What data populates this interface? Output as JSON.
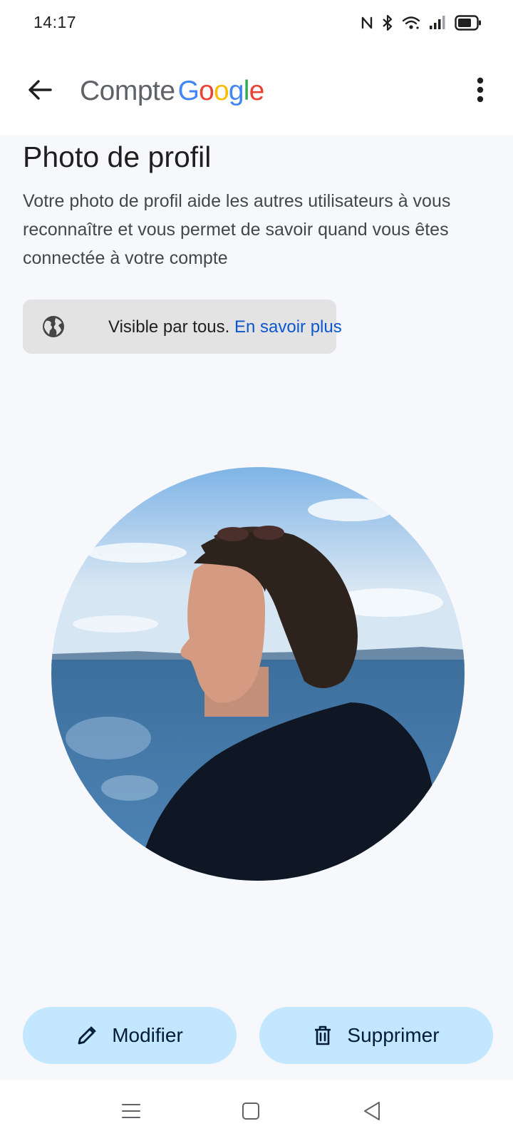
{
  "status_bar": {
    "time": "14:17",
    "icons": [
      "nfc-icon",
      "bluetooth-icon",
      "wifi-icon",
      "signal-icon",
      "battery-icon"
    ]
  },
  "app_bar": {
    "back_icon": "arrow-back-icon",
    "title_word": "Compte",
    "brand_letters": [
      {
        "char": "G",
        "color": "#4285F4"
      },
      {
        "char": "o",
        "color": "#EA4335"
      },
      {
        "char": "o",
        "color": "#FBBC05"
      },
      {
        "char": "g",
        "color": "#4285F4"
      },
      {
        "char": "l",
        "color": "#34A853"
      },
      {
        "char": "e",
        "color": "#EA4335"
      }
    ],
    "menu_icon": "more-vert-icon"
  },
  "page": {
    "title": "Photo de profil",
    "description": "Votre photo de profil aide les autres utilisateurs à vous reconnaître et vous permet de savoir quand vous êtes connectée à votre compte",
    "visibility": {
      "icon": "globe-icon",
      "text": "Visible par tous.",
      "link": "En savoir plus"
    }
  },
  "actions": {
    "edit_label": "Modifier",
    "edit_icon": "pencil-icon",
    "delete_label": "Supprimer",
    "delete_icon": "trash-icon"
  },
  "nav_bar": {
    "icons": [
      "menu-icon",
      "home-square-icon",
      "back-triangle-icon"
    ]
  },
  "colors": {
    "link": "#0b57d0",
    "button_bg": "#c2e7ff",
    "chip_bg": "#e3e3e3"
  }
}
